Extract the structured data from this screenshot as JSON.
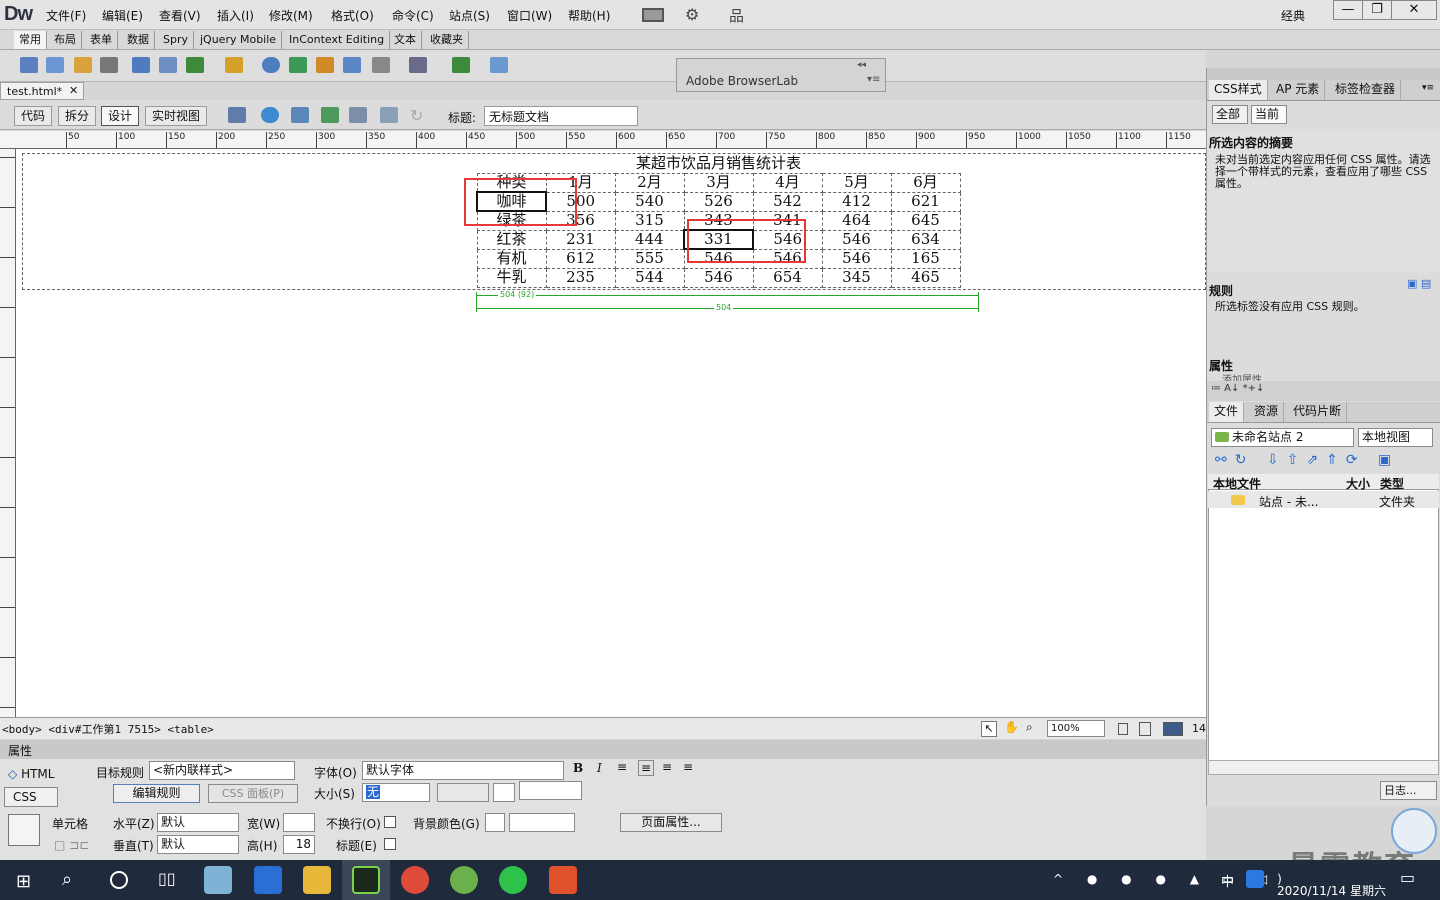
{
  "app": {
    "logo": "Dw",
    "workspace": "经典"
  },
  "menu": [
    "文件(F)",
    "编辑(E)",
    "查看(V)",
    "插入(I)",
    "修改(M)",
    "格式(O)",
    "命令(C)",
    "站点(S)",
    "窗口(W)",
    "帮助(H)"
  ],
  "insert_tabs": [
    "常用",
    "布局",
    "表单",
    "数据",
    "Spry",
    "jQuery Mobile",
    "InContext Editing",
    "文本",
    "收藏夹"
  ],
  "browserlab": {
    "title": "Adobe BrowserLab"
  },
  "document": {
    "tab": "test.html*",
    "views": [
      "代码",
      "拆分",
      "设计",
      "实时视图"
    ],
    "title_label": "标题:",
    "title_value": "无标题文档"
  },
  "ruler_labels": [
    "50",
    "100",
    "150",
    "200",
    "250",
    "300",
    "350",
    "400",
    "450",
    "500",
    "550",
    "600",
    "650",
    "700",
    "750",
    "800",
    "850",
    "900",
    "950",
    "1000",
    "1050",
    "1100",
    "1150"
  ],
  "table": {
    "caption": "某超市饮品月销售统计表",
    "header": [
      "种类",
      "1月",
      "2月",
      "3月",
      "4月",
      "5月",
      "6月"
    ],
    "rows": [
      [
        "咖啡",
        "500",
        "540",
        "526",
        "542",
        "412",
        "621"
      ],
      [
        "绿茶",
        "356",
        "315",
        "343",
        "341",
        "464",
        "645"
      ],
      [
        "红茶",
        "231",
        "444",
        "331",
        "546",
        "546",
        "634"
      ],
      [
        "有机",
        "612",
        "555",
        "546",
        "546",
        "546",
        "165"
      ],
      [
        "牛乳",
        "235",
        "544",
        "546",
        "654",
        "345",
        "465"
      ]
    ],
    "width_label_col": "504 (92)",
    "width_label_table": "504"
  },
  "statusbar": {
    "tag_path": "<body> <div#工作第1 7515> <table>",
    "zoom": "100%",
    "size": "14"
  },
  "properties": {
    "header": "属性",
    "html_btn": "HTML",
    "css_btn": "CSS",
    "target_rule_label": "目标规则",
    "target_rule_value": "<新内联样式>",
    "edit_rule_btn": "编辑规则",
    "css_panel_btn": "CSS 面板(P)",
    "font_label": "字体(O)",
    "font_value": "默认字体",
    "size_label": "大小(S)",
    "size_value": "无",
    "cell_label": "单元格",
    "horiz_label": "水平(Z)",
    "horiz_value": "默认",
    "vert_label": "垂直(T)",
    "vert_value": "默认",
    "width_label": "宽(W)",
    "height_label": "高(H)",
    "height_value": "18",
    "nowrap_label": "不换行(O)",
    "header_label": "标题(E)",
    "bg_label": "背景颜色(G)",
    "page_props_btn": "页面属性..."
  },
  "right_panel": {
    "tabs": [
      "CSS样式",
      "AP 元素",
      "标签检查器"
    ],
    "modes": [
      "全部",
      "当前"
    ],
    "summary_title": "所选内容的摘要",
    "summary_text": "未对当前选定内容应用任何 CSS 属性。请选择一个带样式的元素，查看应用了哪些 CSS 属性。",
    "rules_title": "规则",
    "rules_text": "所选标签没有应用 CSS 规则。",
    "props_title": "属性",
    "add_prop": "添加属性",
    "files_tabs": [
      "文件",
      "资源",
      "代码片断"
    ],
    "site_select": "未命名站点 2",
    "view_select": "本地视图",
    "col_local": "本地文件",
    "col_size": "大小",
    "col_type": "类型",
    "file_row_name": "站点 - 未...",
    "file_row_type": "文件夹",
    "log_btn": "日志..."
  },
  "taskbar": {
    "time": "",
    "date": "2020/11/14 星期六",
    "ime": "中"
  },
  "watermark": "最需教育"
}
